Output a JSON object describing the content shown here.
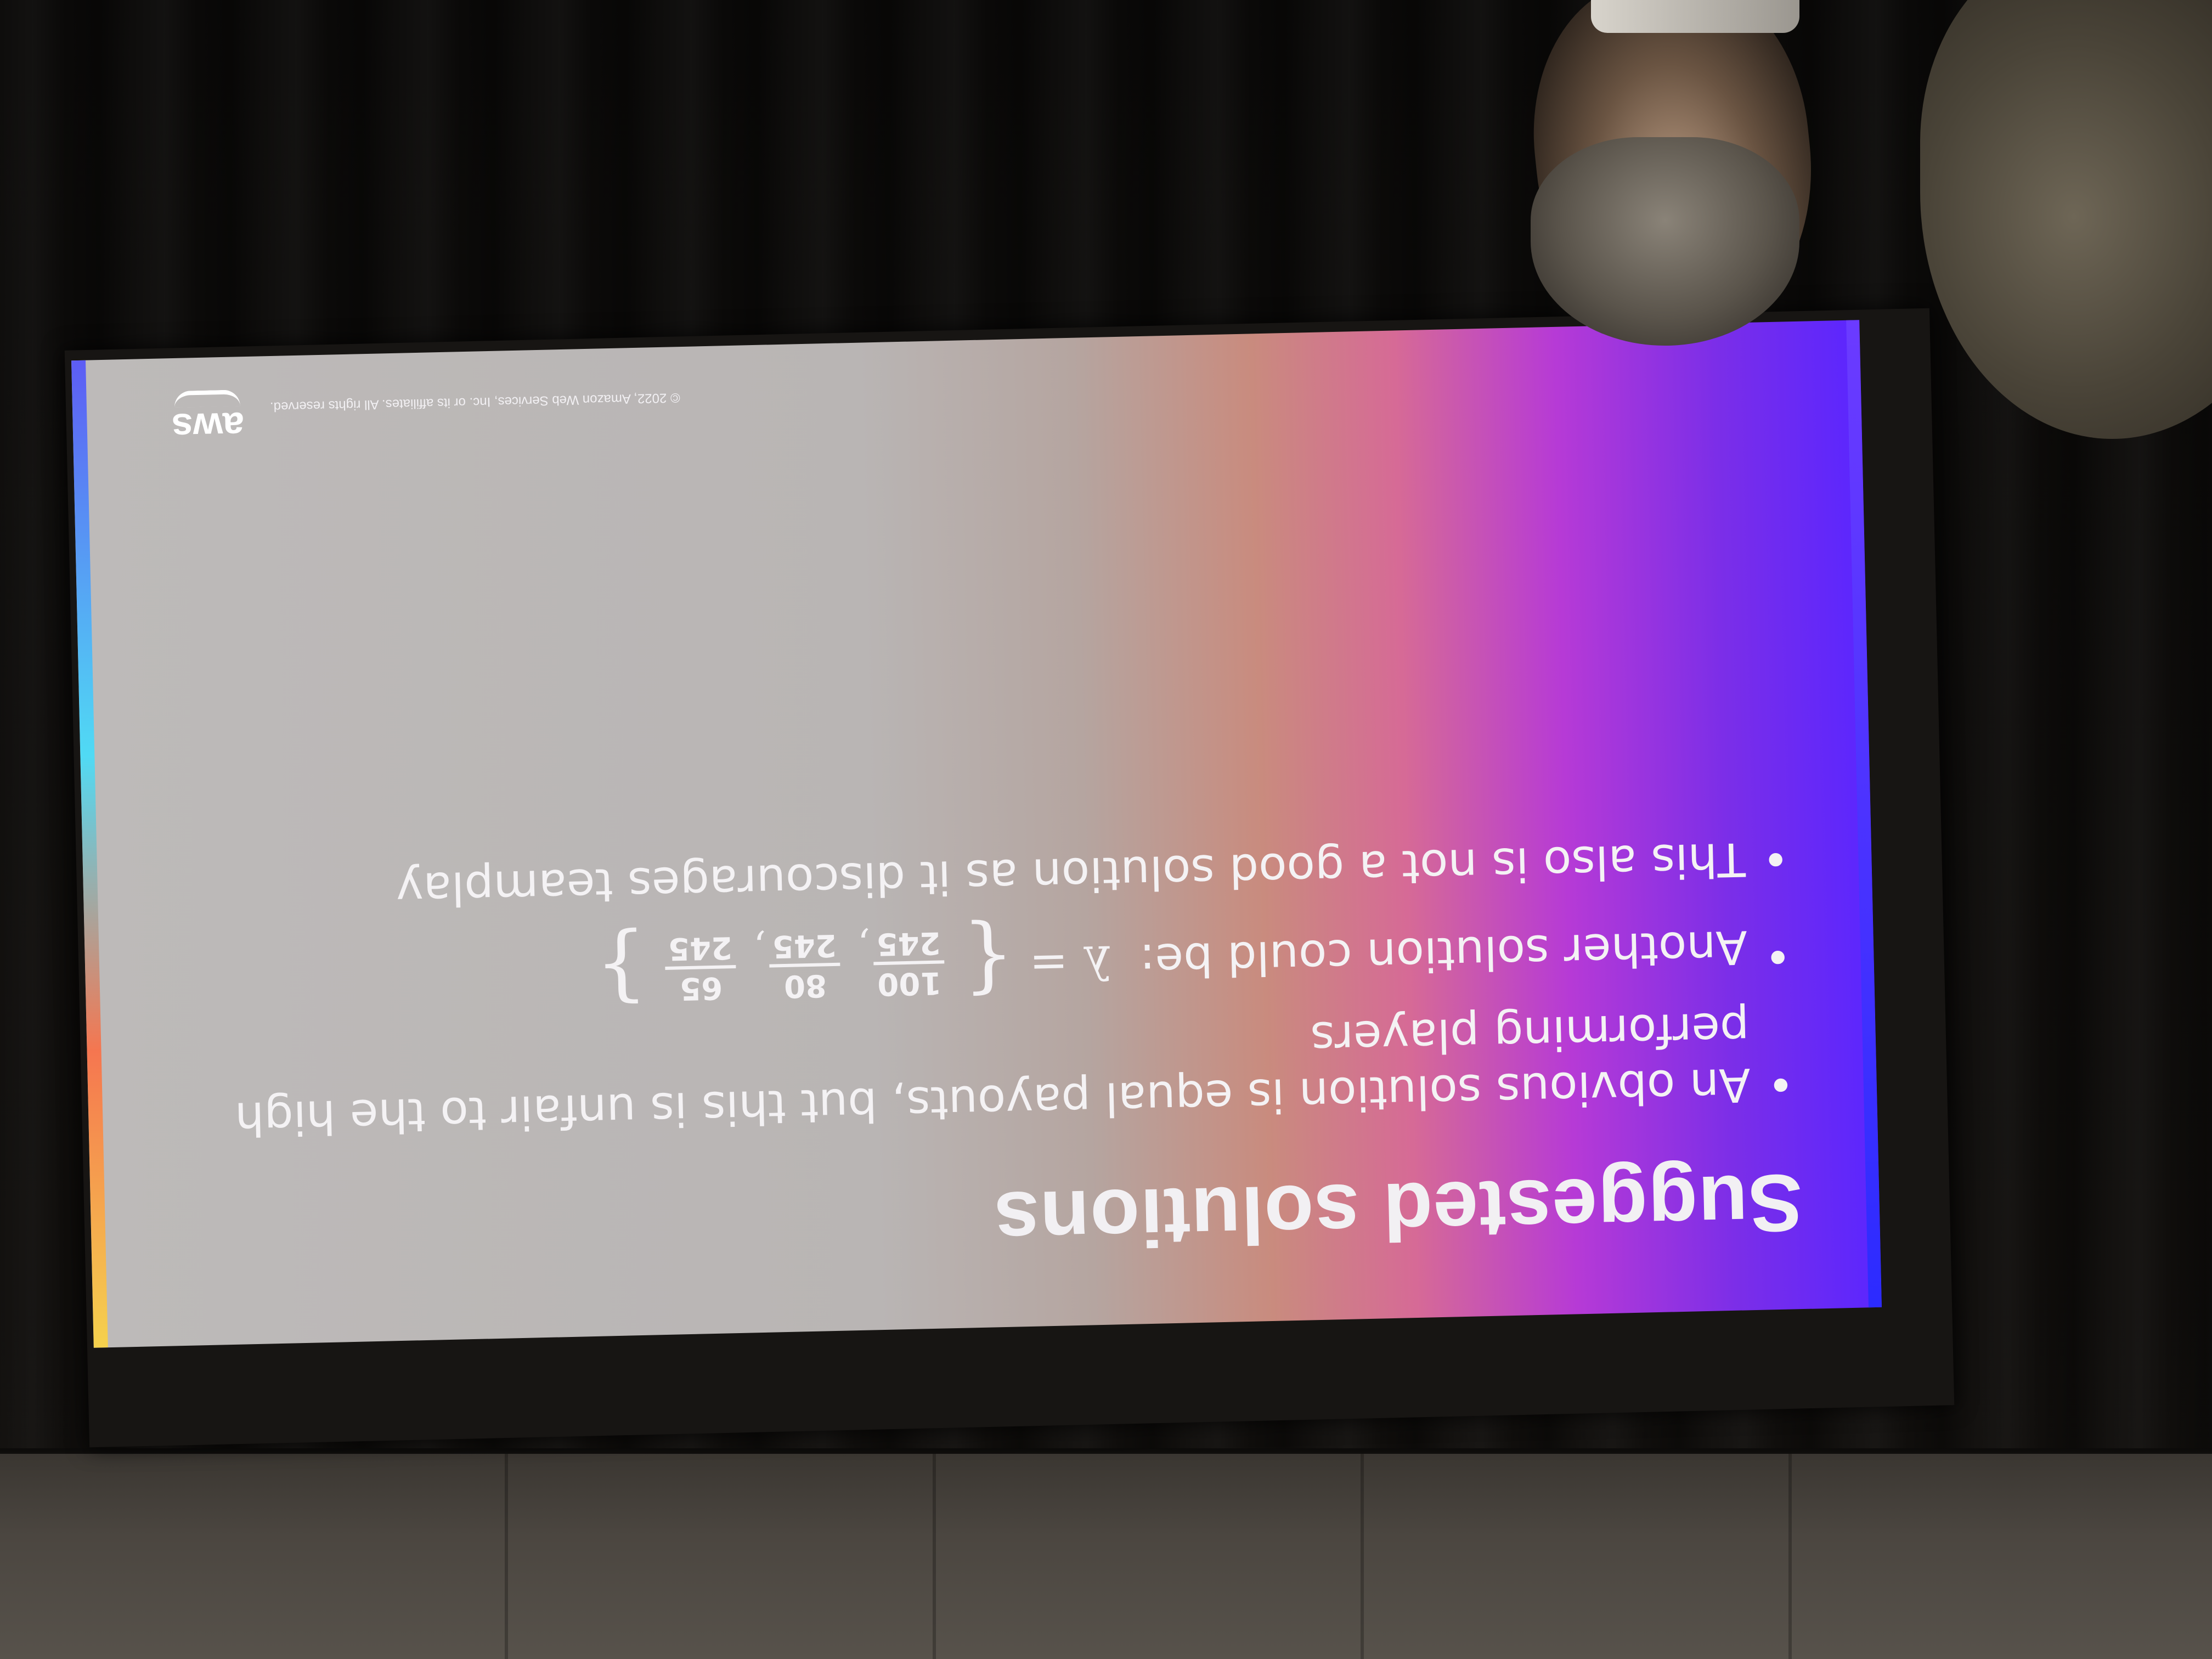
{
  "slide": {
    "title": "Suggested solutions",
    "bullets": [
      "An obvious solution is equal payouts, but this is unfair to the high performing players",
      "Another solution could be:",
      "This also is not a good solution as it discourages teamplay"
    ],
    "formula": {
      "lhs": "λ =",
      "open_brace": "{",
      "close_brace": "}",
      "fractions": [
        {
          "num": "100",
          "den": "245"
        },
        {
          "num": "80",
          "den": "245"
        },
        {
          "num": "65",
          "den": "245"
        }
      ],
      "separator": ","
    },
    "footer": {
      "copyright": "© 2022, Amazon Web Services, Inc. or its affiliates. All rights reserved.",
      "logo": "aws"
    }
  }
}
